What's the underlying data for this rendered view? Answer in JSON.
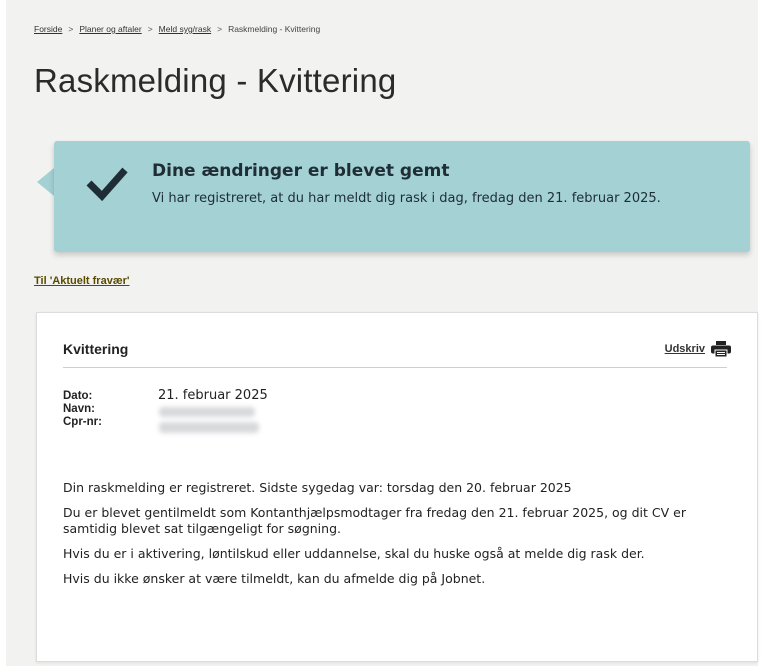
{
  "breadcrumb": {
    "items": [
      "Forside",
      "Planer og aftaler",
      "Meld syg/rask"
    ],
    "current": "Raskmelding - Kvittering",
    "separator": ">"
  },
  "page": {
    "title": "Raskmelding - Kvittering"
  },
  "banner": {
    "icon": "checkmark-icon",
    "heading": "Dine ændringer er blevet gemt",
    "text": "Vi har registreret, at du har meldt dig rask i dag, fredag den 21. februar 2025.",
    "color": "#a3d1d4"
  },
  "back_link": {
    "label": "Til 'Aktuelt fravær'"
  },
  "receipt": {
    "title": "Kvittering",
    "print_label": "Udskriv",
    "print_icon": "printer-icon",
    "fields": {
      "date_label": "Dato:",
      "date_value": "21. februar 2025",
      "name_label": "Navn:",
      "cpr_label": "Cpr-nr:"
    },
    "paragraphs": [
      "Din raskmelding er registreret. Sidste sygedag var: torsdag den 20. februar 2025",
      "Du er blevet gentilmeldt som Kontanthjælpsmodtager fra fredag den 21. februar 2025, og dit CV er samtidig blevet sat tilgængeligt for søgning.",
      "Hvis du er i aktivering, løntilskud eller uddannelse, skal du huske også at melde dig rask der.",
      "Hvis du ikke ønsker at være tilmeldt, kan du afmelde dig på Jobnet."
    ]
  }
}
